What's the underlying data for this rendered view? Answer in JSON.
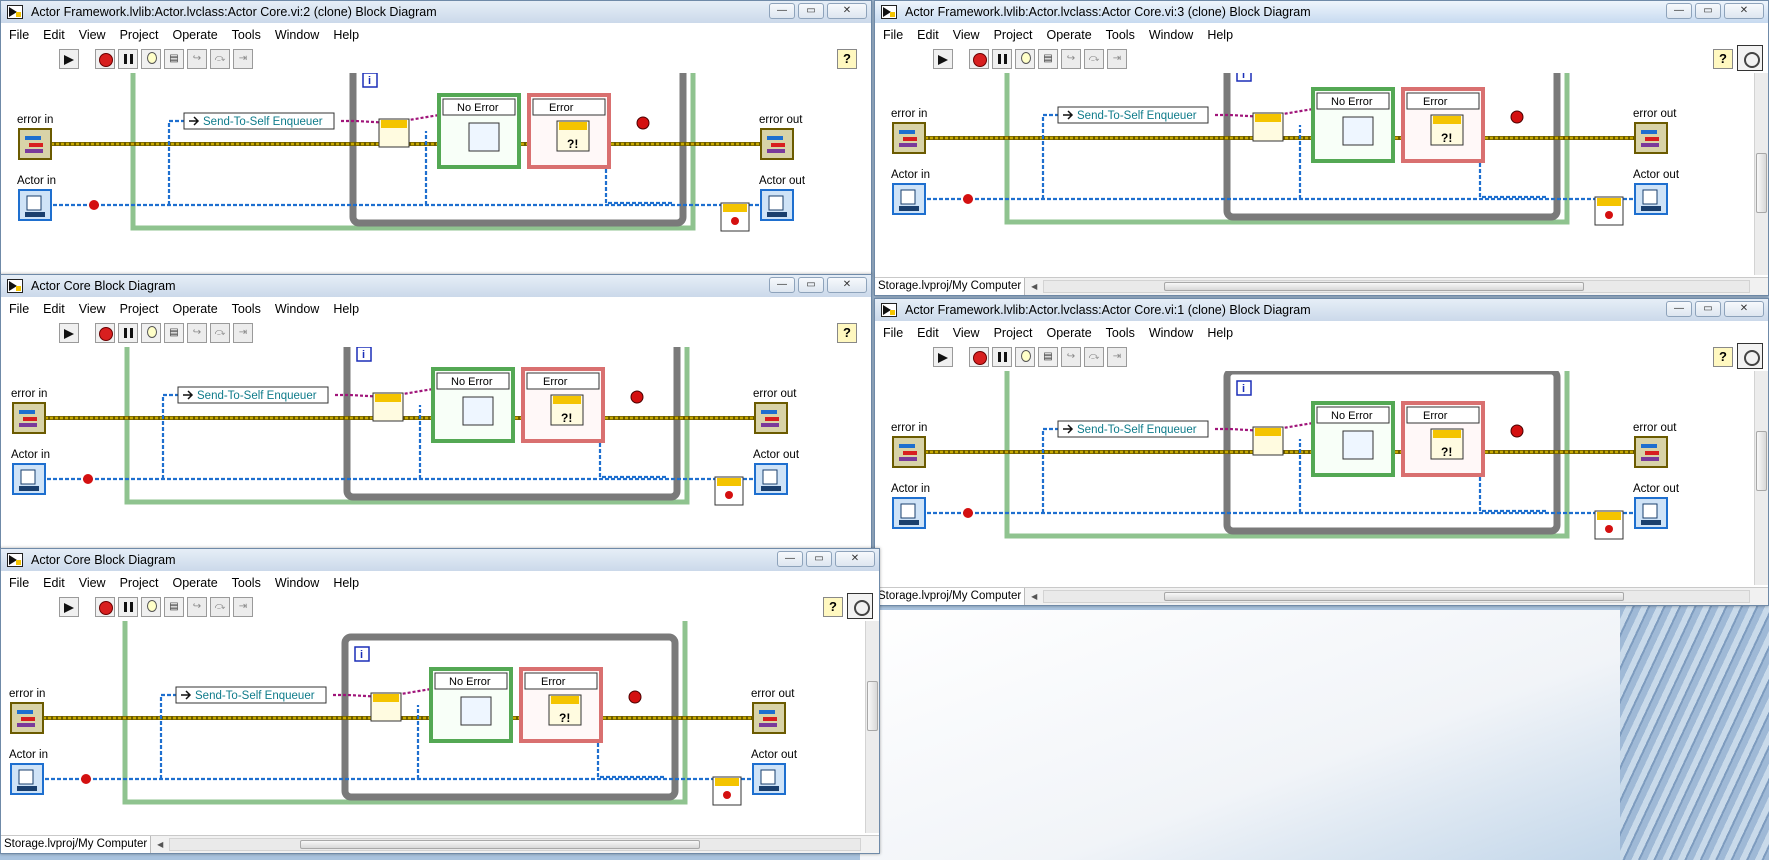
{
  "desktop": {
    "background": "#a9c3de"
  },
  "menu": [
    "File",
    "Edit",
    "View",
    "Project",
    "Operate",
    "Tools",
    "Window",
    "Help"
  ],
  "windows": [
    {
      "title": "Actor Framework.lvlib:Actor.lvclass:Actor Core.vi:2 (clone) Block Diagram",
      "status_path": "",
      "active": false
    },
    {
      "title": "Actor Framework.lvlib:Actor.lvclass:Actor Core.vi:3 (clone) Block Diagram",
      "status_path": "Storage.lvproj/My Computer",
      "active": true
    },
    {
      "title": "Actor Core Block Diagram",
      "status_path": "",
      "active": false
    },
    {
      "title": "Actor Framework.lvlib:Actor.lvclass:Actor Core.vi:1 (clone) Block Diagram",
      "status_path": "Storage.lvproj/My Computer",
      "active": false
    },
    {
      "title": "Actor Core Block Diagram",
      "status_path": "Storage.lvproj/My Computer",
      "active": false
    }
  ],
  "diagram": {
    "error_in": "error in",
    "actor_in": "Actor in",
    "error_out": "error out",
    "actor_out": "Actor out",
    "enqueuer": "Send-To-Self Enqueuer",
    "case_no_error": "No Error",
    "case_error": "Error",
    "loop_iteration": "i"
  },
  "colors": {
    "error_wire": "#c6a800",
    "class_wire": "#1e6fcf",
    "refnum_wire": "#a0157a",
    "stop": "#d41010",
    "case_ok": "#54a854",
    "case_err": "#d97070",
    "loop": "#7a7a7a"
  }
}
